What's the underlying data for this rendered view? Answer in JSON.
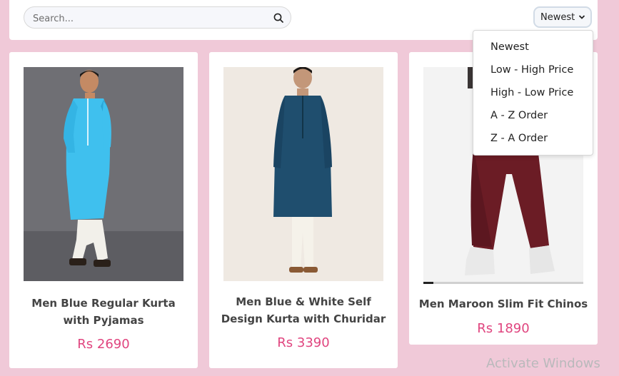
{
  "search": {
    "placeholder": "Search..."
  },
  "sort": {
    "selected": "Newest",
    "options": [
      "Newest",
      "Low - High Price",
      "High - Low Price",
      "A - Z Order",
      "Z - A Order"
    ]
  },
  "products": [
    {
      "name": "Men Blue Regular Kurta with Pyjamas",
      "price": "Rs 2690"
    },
    {
      "name": "Men Blue & White Self Design Kurta with Churidar",
      "price": "Rs 3390"
    },
    {
      "name": "Men Maroon Slim Fit Chinos",
      "price": "Rs 1890"
    }
  ],
  "watermark": "Activate Windows",
  "colors": {
    "background": "#f0c9d8",
    "price": "#e0457f",
    "kurta_light_blue": "#3fc0ee",
    "kurta_teal": "#1f4e6e",
    "chinos_maroon": "#6b1c25"
  }
}
